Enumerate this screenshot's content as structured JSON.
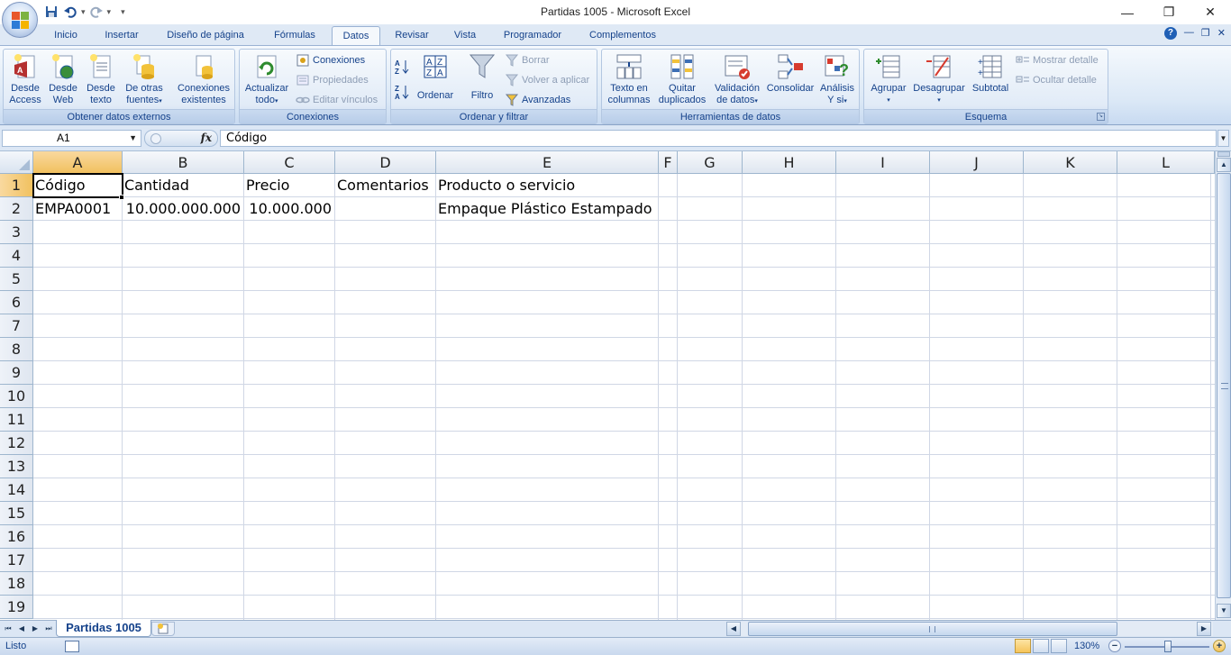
{
  "window": {
    "title": "Partidas 1005 - Microsoft Excel",
    "minimize": "—",
    "restore": "❐",
    "close": "✕"
  },
  "qat": {
    "save": "save-icon",
    "undo": "undo-icon",
    "redo": "redo-icon",
    "customize": "▾"
  },
  "tabs": [
    "Inicio",
    "Insertar",
    "Diseño de página",
    "Fórmulas",
    "Datos",
    "Revisar",
    "Vista",
    "Programador",
    "Complementos"
  ],
  "active_tab": "Datos",
  "ribbon": {
    "groups": {
      "external": "Obtener datos externos",
      "connections": "Conexiones",
      "sort": "Ordenar y filtrar",
      "tools": "Herramientas de datos",
      "outline": "Esquema"
    },
    "buttons": {
      "access_1": "Desde",
      "access_2": "Access",
      "web_1": "Desde",
      "web_2": "Web",
      "text_1": "Desde",
      "text_2": "texto",
      "other_1": "De otras",
      "other_2": "fuentes",
      "existing_1": "Conexiones",
      "existing_2": "existentes",
      "refresh_1": "Actualizar",
      "refresh_2": "todo",
      "connections": "Conexiones",
      "properties": "Propiedades",
      "edit_links": "Editar vínculos",
      "sort": "Ordenar",
      "filter": "Filtro",
      "clear": "Borrar",
      "reapply": "Volver a aplicar",
      "advanced": "Avanzadas",
      "text_cols_1": "Texto en",
      "text_cols_2": "columnas",
      "dups_1": "Quitar",
      "dups_2": "duplicados",
      "validation_1": "Validación",
      "validation_2": "de datos",
      "consolidate": "Consolidar",
      "whatif_1": "Análisis",
      "whatif_2": "Y si",
      "group": "Agrupar",
      "ungroup": "Desagrupar",
      "subtotal": "Subtotal",
      "show_detail": "Mostrar detalle",
      "hide_detail": "Ocultar detalle"
    }
  },
  "formula_bar": {
    "name_box": "A1",
    "fx": "fx",
    "content": "Código"
  },
  "columns": [
    "A",
    "B",
    "C",
    "D",
    "E",
    "F",
    "G",
    "H",
    "I",
    "J",
    "K",
    "L"
  ],
  "rows": [
    "1",
    "2",
    "3",
    "4",
    "5",
    "6",
    "7",
    "8",
    "9",
    "10",
    "11",
    "12",
    "13",
    "14",
    "15",
    "16",
    "17",
    "18",
    "19"
  ],
  "cells": {
    "A1": "Código",
    "B1": "Cantidad",
    "C1": "Precio",
    "D1": "Comentarios",
    "E1": "Producto o servicio",
    "A2": "EMPA0001",
    "B2": "10.000.000.000",
    "C2": "10.000.000",
    "E2": "Empaque Plástico Estampado"
  },
  "sheet_tab": "Partidas 1005",
  "status": {
    "ready": "Listo",
    "zoom": "130%"
  },
  "colors": {
    "ribbon_bg": "#dbe8f6",
    "active_header": "#f1c15f",
    "text_blue": "#15428b"
  }
}
